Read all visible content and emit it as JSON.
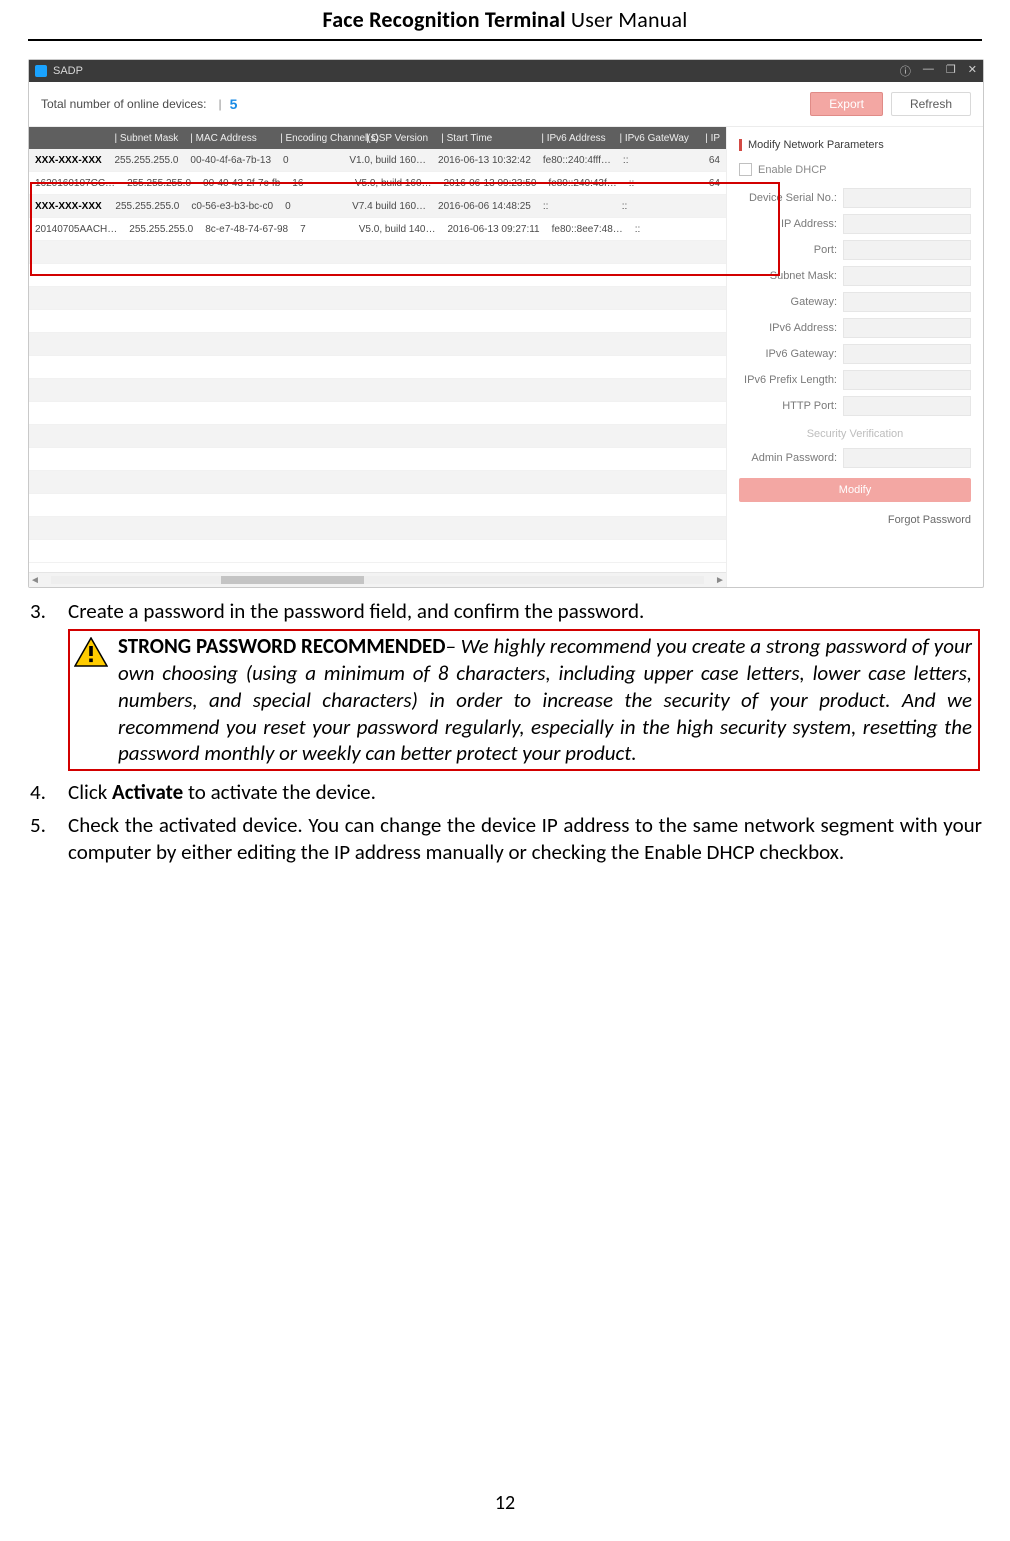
{
  "header": {
    "bold": "Face Recognition Terminal",
    "plain": "  User Manual"
  },
  "page_number": "12",
  "app": {
    "titlebar": {
      "name": "SADP",
      "icons": {
        "info": "ⓘ",
        "min": "—",
        "max": "❐",
        "close": "✕"
      }
    },
    "toolbar": {
      "label": "Total number of online devices:",
      "count": "5",
      "export": "Export",
      "refresh": "Refresh"
    },
    "columns": [
      "| Subnet Mask",
      "| MAC Address",
      "| Encoding Channel(s)",
      "| DSP Version",
      "| Start Time",
      "| IPv6 Address",
      "| IPv6 GateWay",
      "| IP"
    ],
    "rows": [
      {
        "dev": "XXX-XXX-XXX",
        "mask": "255.255.255.0",
        "mac": "00-40-4f-6a-7b-13",
        "ch": "0",
        "dsp": "V1.0, build 160…",
        "start": "2016-06-13 10:32:42",
        "v6": "fe80::240:4fff…",
        "gw": "::",
        "ip": "64",
        "devclass": "xxx"
      },
      {
        "dev": "1620160107CC…",
        "mask": "255.255.255.0",
        "mac": "00-40-43-2f-7c-fb",
        "ch": "16",
        "dsp": "V5.0, build 160…",
        "start": "2016-06-13 09:23:50",
        "v6": "fe80::240:43f…",
        "gw": "::",
        "ip": "64"
      },
      {
        "dev": "XXX-XXX-XXX",
        "mask": "255.255.255.0",
        "mac": "c0-56-e3-b3-bc-c0",
        "ch": "0",
        "dsp": "V7.4 build 160…",
        "start": "2016-06-06 14:48:25",
        "v6": "::",
        "gw": "::",
        "ip": "",
        "devclass": "xxx"
      },
      {
        "dev": "20140705AACH…",
        "mask": "255.255.255.0",
        "mac": "8c-e7-48-74-67-98",
        "ch": "7",
        "dsp": "V5.0, build 140…",
        "start": "2016-06-13 09:27:11",
        "v6": "fe80::8ee7:48…",
        "gw": "::",
        "ip": ""
      }
    ],
    "panel": {
      "title": "Modify Network Parameters",
      "enable_dhcp": "Enable DHCP",
      "fields": {
        "serial": "Device Serial No.:",
        "ip": "IP Address:",
        "port": "Port:",
        "mask": "Subnet Mask:",
        "gw": "Gateway:",
        "v6": "IPv6 Address:",
        "v6gw": "IPv6 Gateway:",
        "v6len": "IPv6 Prefix Length:",
        "http": "HTTP Port:",
        "admin": "Admin Password:"
      },
      "security_verification": "Security Verification",
      "modify": "Modify",
      "forgot": "Forgot Password"
    }
  },
  "steps": {
    "s3": {
      "n": "3.",
      "t": "Create a password in the password field, and confirm the password."
    },
    "warn_lead": "STRONG PASSWORD RECOMMENDED",
    "warn_body": "– We highly recommend you create a strong password of your own choosing (using a minimum of 8 characters, including upper case letters, lower case letters, numbers, and special characters) in order to increase the security of your product. And we recommend you reset your password regularly, especially in the high security system, resetting the password monthly or weekly can better protect your product.",
    "s4": {
      "n": "4.",
      "pre": "Click ",
      "bold": "Activate",
      "post": " to activate the device."
    },
    "s5": {
      "n": "5.",
      "t": "Check the activated device. You can change the device IP address to the same network segment with your computer by either editing the IP address manually or checking the Enable DHCP checkbox."
    }
  }
}
